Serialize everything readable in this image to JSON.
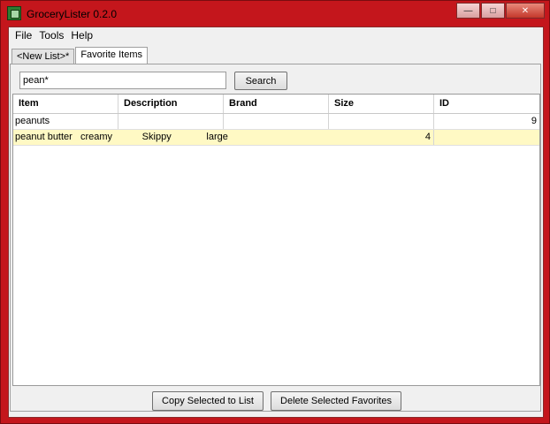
{
  "window": {
    "title": "GroceryLister 0.2.0"
  },
  "window_controls": {
    "minimize": "—",
    "maximize": "□",
    "close": "✕"
  },
  "menu": [
    "File",
    "Tools",
    "Help"
  ],
  "tabs": [
    {
      "label": "<New List>*",
      "active": false
    },
    {
      "label": "Favorite Items",
      "active": true
    }
  ],
  "search": {
    "value": "pean*",
    "button": "Search"
  },
  "table": {
    "columns": [
      "Item",
      "Description",
      "Brand",
      "Size",
      "ID"
    ],
    "rows": [
      {
        "item": "peanuts",
        "description": "",
        "brand": "",
        "size": "",
        "id": "9"
      }
    ],
    "selected_row": {
      "text": "peanut butter   creamy           Skippy             large",
      "id": "4"
    }
  },
  "buttons": {
    "copy": "Copy Selected to List",
    "delete": "Delete Selected Favorites"
  },
  "colors": {
    "frame": "#c4161c",
    "selection": "#fff9c4"
  }
}
